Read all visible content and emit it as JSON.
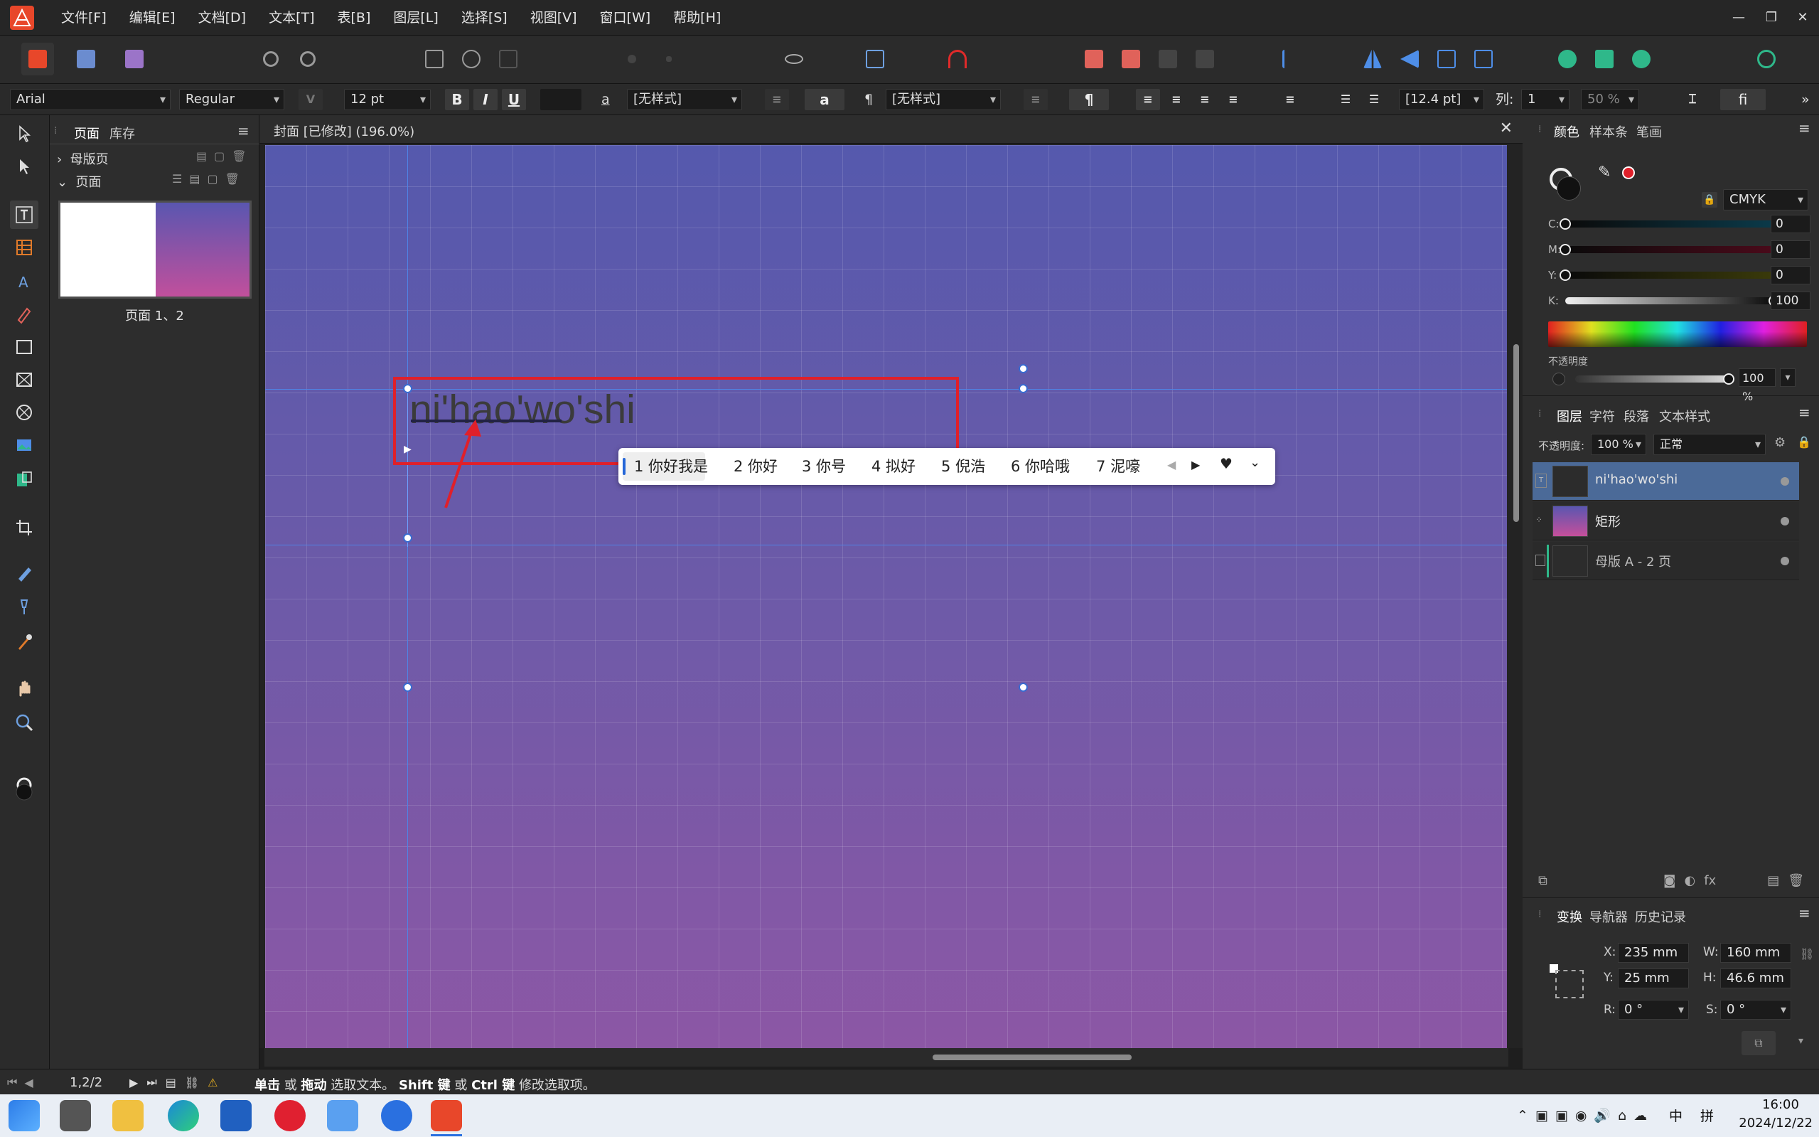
{
  "menubar": {
    "items": [
      "文件[F]",
      "编辑[E]",
      "文档[D]",
      "文本[T]",
      "表[B]",
      "图层[L]",
      "选择[S]",
      "视图[V]",
      "窗口[W]",
      "帮助[H]"
    ]
  },
  "context_toolbar": {
    "font_family": "Arial",
    "font_style": "Regular",
    "font_size": "12 pt",
    "bold": "B",
    "italic": "I",
    "underline": "U",
    "char_style_icon": "a",
    "char_style": "[无样式]",
    "char_a": "a",
    "para_icon": "¶",
    "para_style": "[无样式]",
    "pilcrow": "¶",
    "leading": "[12.4 pt]",
    "columns_label": "列:",
    "columns_value": "1",
    "percent": "50 %",
    "fi_label": "fi"
  },
  "pages_panel": {
    "tabs": [
      "页面",
      "库存"
    ],
    "master_section": "母版页",
    "pages_section": "页面",
    "thumb_label": "页面 1、2"
  },
  "document": {
    "tab_title": "封面 [已修改] (196.0%)",
    "typed_text": "ni'hao'wo'shi"
  },
  "ime": {
    "candidates": [
      "1 你好我是",
      "2 你好",
      "3 你号",
      "4 拟好",
      "5 倪浩",
      "6 你哈哦",
      "7 泥嚎"
    ]
  },
  "color_panel": {
    "tabs": [
      "颜色",
      "样本条",
      "笔画"
    ],
    "model": "CMYK",
    "channels": [
      {
        "label": "C:",
        "value": "0",
        "level": 0
      },
      {
        "label": "M:",
        "value": "0",
        "level": 0
      },
      {
        "label": "Y:",
        "value": "0",
        "level": 0
      },
      {
        "label": "K:",
        "value": "100",
        "level": 1
      }
    ],
    "opacity_label": "不透明度",
    "opacity_value": "100 %"
  },
  "layers_panel": {
    "tabs": [
      "图层",
      "字符",
      "段落",
      "文本样式"
    ],
    "opacity_label": "不透明度:",
    "opacity_value": "100 %",
    "blend_mode": "正常",
    "layers": [
      {
        "name": "ni'hao'wo'shi",
        "selected": true
      },
      {
        "name": "矩形",
        "selected": false
      },
      {
        "name": "母版 A - 2 页",
        "selected": false
      }
    ]
  },
  "transform_panel": {
    "tabs": [
      "变换",
      "导航器",
      "历史记录"
    ],
    "x_label": "X:",
    "x_value": "235 mm",
    "y_label": "Y:",
    "y_value": "25 mm",
    "w_label": "W:",
    "w_value": "160 mm",
    "h_label": "H:",
    "h_value": "46.6 mm",
    "r_label": "R:",
    "r_value": "0 °",
    "s_label": "S:",
    "s_value": "0 °"
  },
  "statusbar": {
    "page_counter": "1,2/2",
    "msg_click": "单击",
    "msg_or1": "或",
    "msg_drag": "拖动",
    "msg_select": "选取文本。",
    "msg_shift": "Shift 键",
    "msg_or2": "或",
    "msg_ctrl": "Ctrl 键",
    "msg_modify": "修改选取项。"
  },
  "taskbar": {
    "ime_lang": "中",
    "ime_mode": "拼",
    "time": "16:00",
    "date": "2024/12/22"
  },
  "colors": {
    "annotation_red": "#e0202a",
    "accent_blue": "#4b6a98",
    "brand": "#e8472a"
  }
}
